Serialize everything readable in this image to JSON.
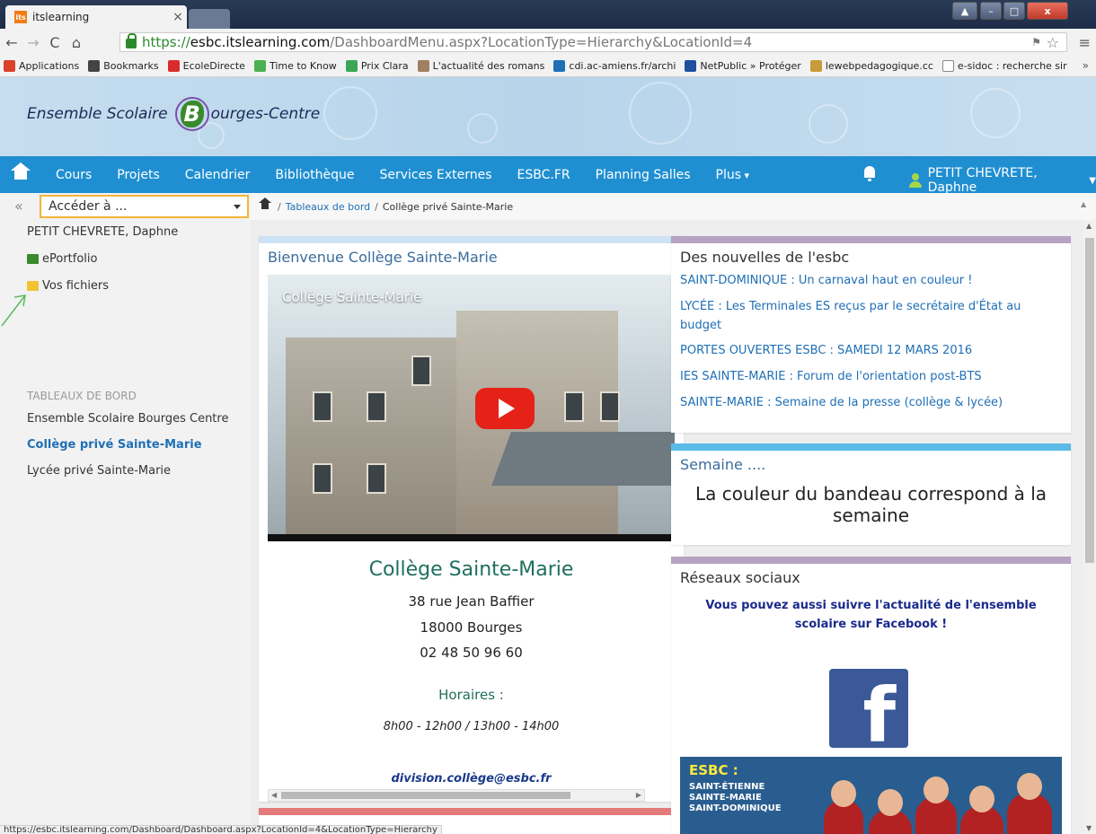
{
  "browser": {
    "tab_title": "itslearning",
    "tab_favicon": "its",
    "tab_close": "×",
    "url_scheme": "https://",
    "url_host": "esbc.itslearning.com",
    "url_path": "/DashboardMenu.aspx?LocationType=Hierarchy&LocationId=4",
    "bookmarks": [
      {
        "label": "Applications",
        "icon": "apps-grid-icon",
        "color": "#d9412b"
      },
      {
        "label": "Bookmarks",
        "icon": "star-icon",
        "color": "#444444"
      },
      {
        "label": "EcoleDirecte",
        "icon": "ecoledirecte-icon",
        "color": "#d92b2b"
      },
      {
        "label": "Time to Know",
        "icon": "time-to-know-icon",
        "color": "#4caf50"
      },
      {
        "label": "Prix Clara",
        "icon": "prix-clara-icon",
        "color": "#3aa655"
      },
      {
        "label": "L'actualité des romans",
        "icon": "book-icon",
        "color": "#a08060"
      },
      {
        "label": "cdi.ac-amiens.fr/archi",
        "icon": "cdi-icon",
        "color": "#1e6fb5"
      },
      {
        "label": "NetPublic » Protéger",
        "icon": "netpublic-icon",
        "color": "#1f4f9e"
      },
      {
        "label": "lewebpedagogique.cc",
        "icon": "lewebpedagogique-icon",
        "color": "#c79a3a"
      },
      {
        "label": "e-sidoc : recherche sir",
        "icon": "page-icon",
        "color": "#ffffff"
      }
    ],
    "bookmarks_more": "»",
    "status_url": "https://esbc.itslearning.com/Dashboard/Dashboard.aspx?LocationId=4&LocationType=Hierarchy"
  },
  "site": {
    "logo_part1": "Ensemble Scolaire",
    "logo_letter": "B",
    "logo_part2": "ourges-Centre",
    "nav": [
      {
        "label": "Cours",
        "caret": false
      },
      {
        "label": "Projets",
        "caret": false
      },
      {
        "label": "Calendrier",
        "caret": false
      },
      {
        "label": "Bibliothèque",
        "caret": false
      },
      {
        "label": "Services Externes",
        "caret": false
      },
      {
        "label": "ESBC.FR",
        "caret": false
      },
      {
        "label": "Planning Salles",
        "caret": false
      },
      {
        "label": "Plus",
        "caret": true
      }
    ],
    "user_name": "PETIT CHEVRETE, Daphne",
    "accent": "#1f8fd1"
  },
  "sidebar": {
    "collapse": "«",
    "access_placeholder": "Accéder à ...",
    "user": "PETIT CHEVRETE, Daphne",
    "items": [
      {
        "label": "ePortfolio",
        "icon": "eportfolio-icon",
        "color": "#3a8a2b"
      },
      {
        "label": "Vos fichiers",
        "icon": "folder-icon",
        "color": "#f1c232"
      }
    ],
    "section_header": "TABLEAUX DE BORD",
    "dashboards": [
      {
        "label": "Ensemble Scolaire Bourges Centre",
        "active": false
      },
      {
        "label": "Collège privé Sainte-Marie",
        "active": true
      },
      {
        "label": "Lycée privé Sainte-Marie",
        "active": false
      }
    ]
  },
  "breadcrumb": {
    "link": "Tableaux de bord",
    "sep": "/",
    "current": "Collège privé Sainte-Marie"
  },
  "welcome": {
    "title": "Bienvenue Collège Sainte-Marie",
    "video_title": "Collège Sainte-Marie",
    "college_name": "Collège Sainte-Marie",
    "address_lines": [
      "38 rue Jean Baffier",
      "18000 Bourges",
      "02 48 50 96 60"
    ],
    "hours_label": "Horaires :",
    "hours": "8h00 - 12h00 / 13h00 - 14h00",
    "email": "division.collège@esbc.fr"
  },
  "news": {
    "title": "Des nouvelles de l'esbc",
    "items": [
      "SAINT-DOMINIQUE : Un carnaval haut en couleur !",
      "LYCÉE : Les Terminales ES reçus par le secrétaire d'État au budget",
      "PORTES OUVERTES ESBC : SAMEDI 12 MARS 2016",
      "IES SAINTE-MARIE : Forum de l'orientation post-BTS",
      "SAINTE-MARIE : Semaine de la presse (collège & lycée)"
    ]
  },
  "week": {
    "title": "Semaine ....",
    "text": "La couleur du bandeau correspond à la semaine"
  },
  "social": {
    "title": "Réseaux sociaux",
    "text": "Vous pouvez aussi suivre l'actualité de l'ensemble scolaire sur Facebook !",
    "fb_letter": "f",
    "banner_title": "ESBC :",
    "banner_lines": [
      "SAINT-ÉTIENNE",
      "SAINTE-MARIE",
      "SAINT-DOMINIQUE"
    ]
  }
}
